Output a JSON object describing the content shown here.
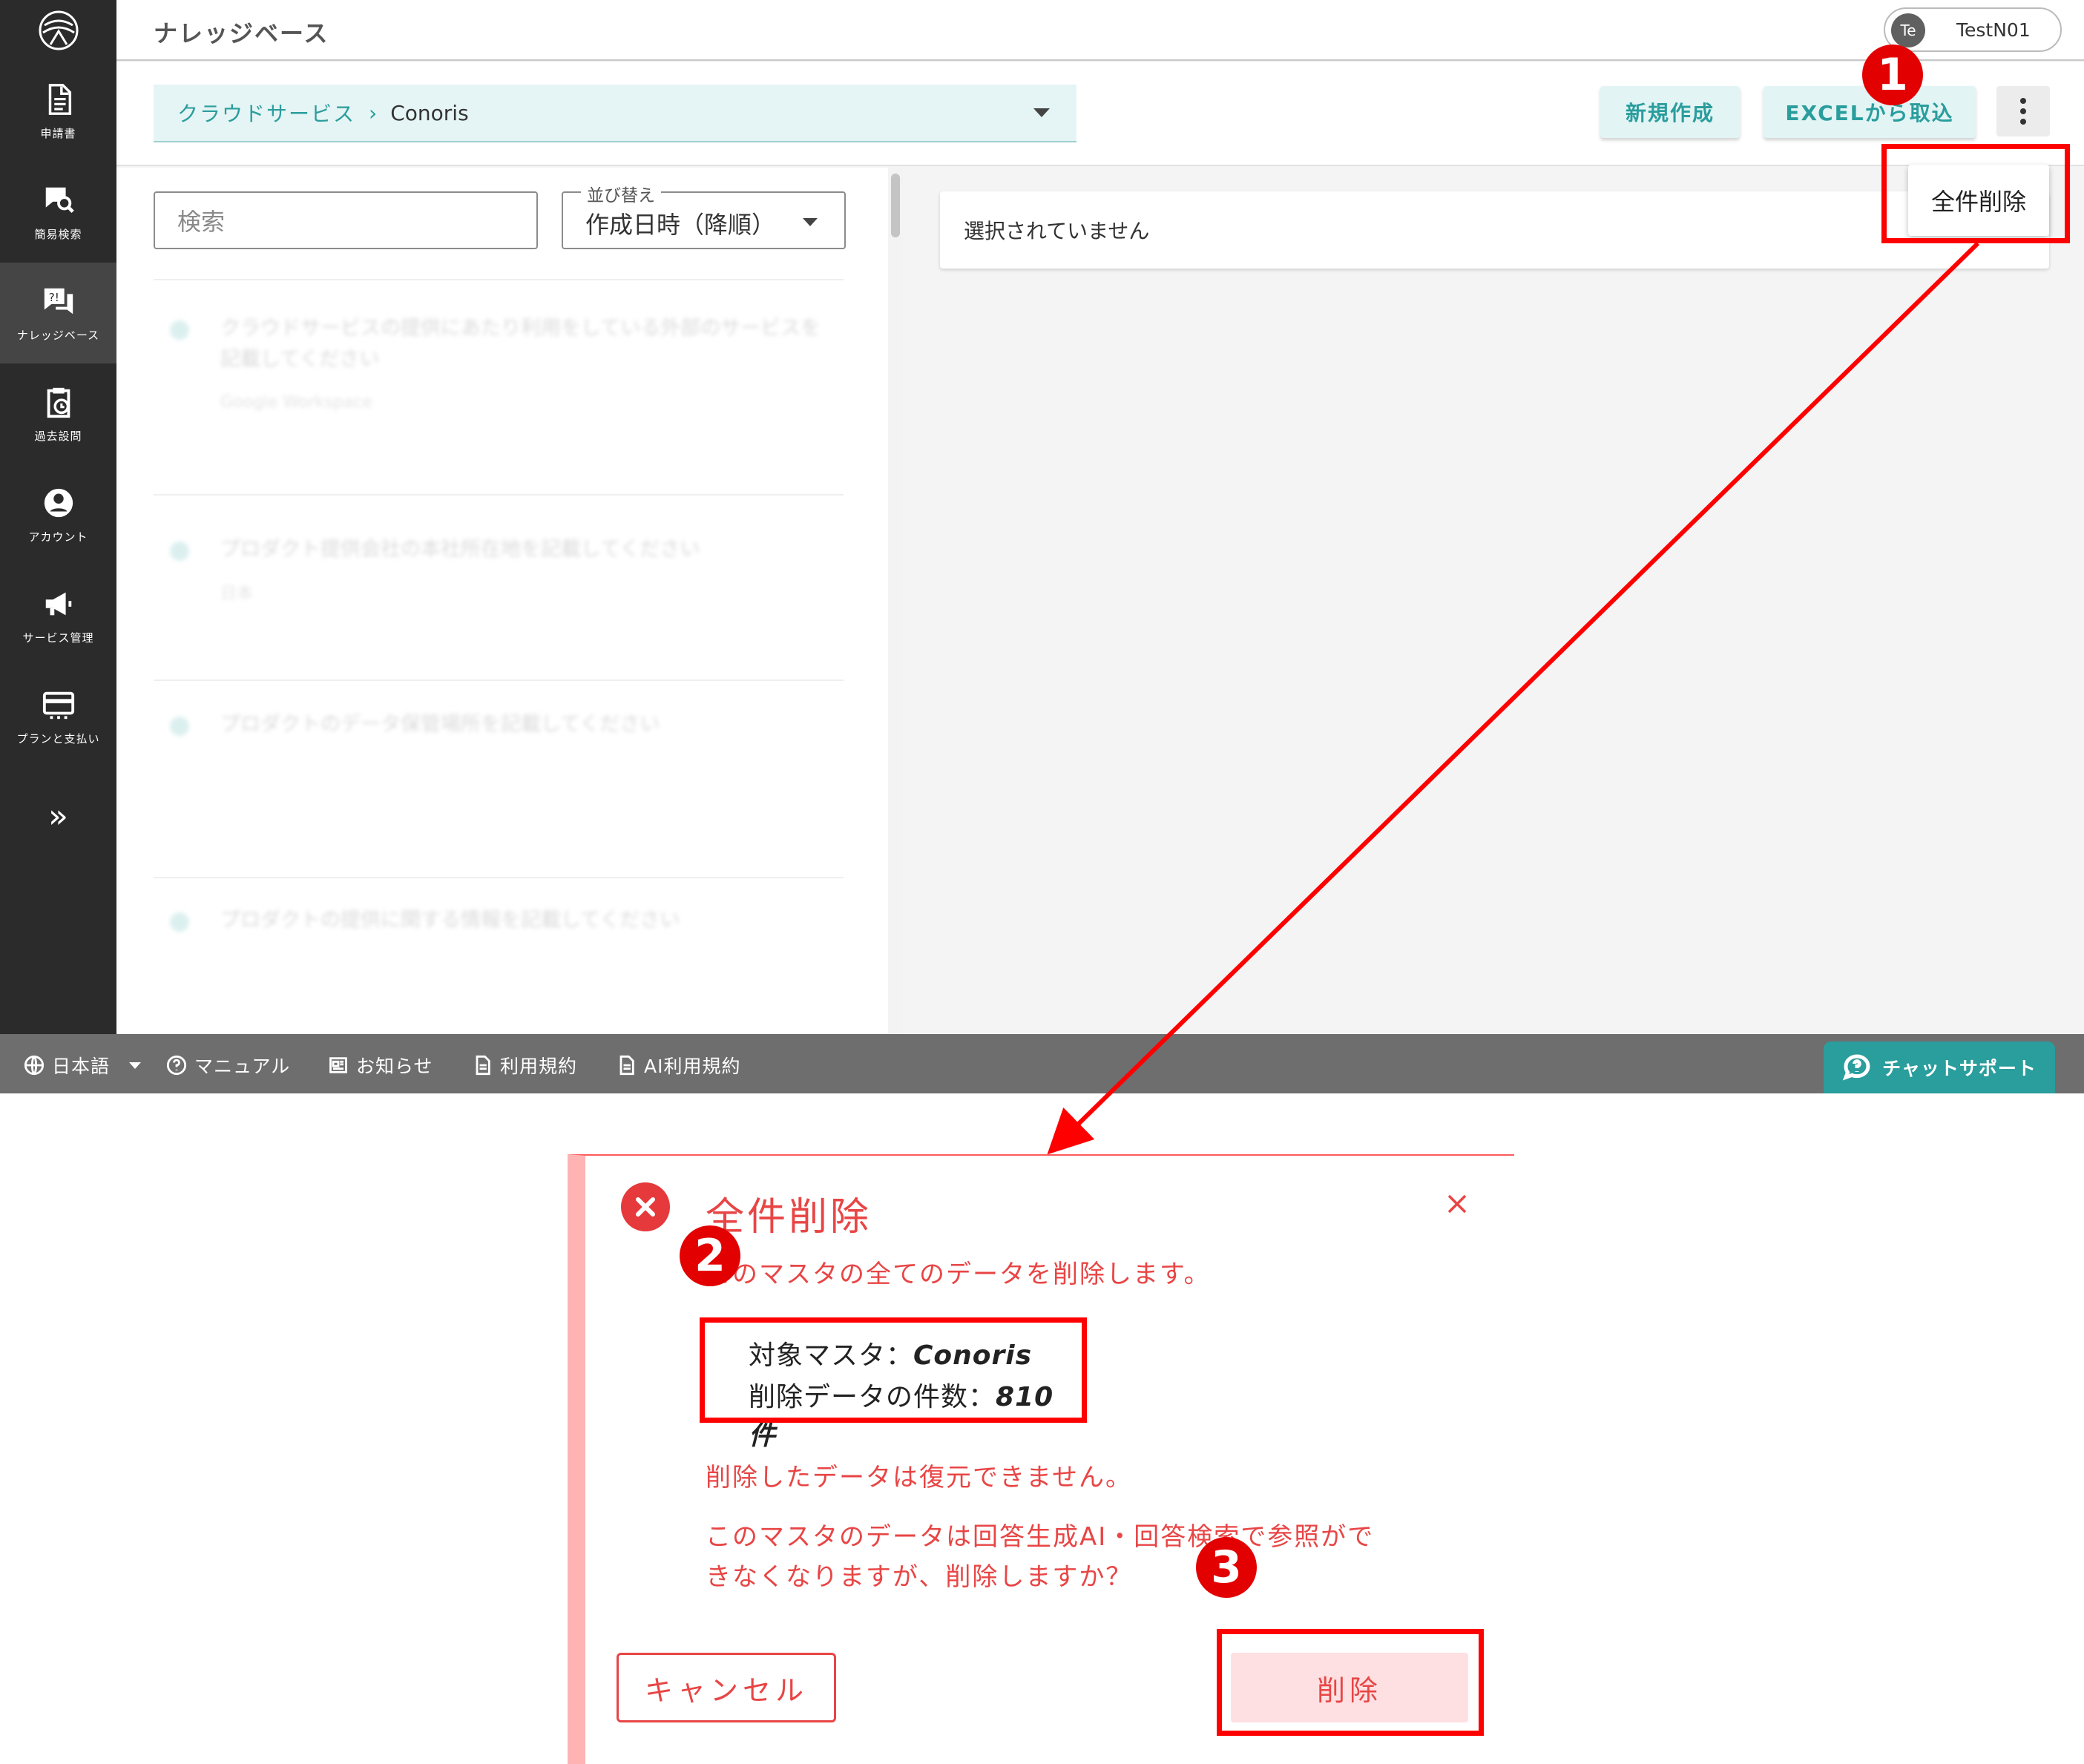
{
  "header": {
    "app_title": "ナレッジベース",
    "user_initials": "Te",
    "user_name": "TestN01"
  },
  "sidebar": {
    "items": [
      {
        "label": "申請書",
        "icon": "document-icon"
      },
      {
        "label": "簡易検索",
        "icon": "chat-search-icon"
      },
      {
        "label": "ナレッジベース",
        "icon": "knowledge-icon",
        "active": true
      },
      {
        "label": "過去設問",
        "icon": "clipboard-clock-icon"
      },
      {
        "label": "アカウント",
        "icon": "account-icon"
      },
      {
        "label": "サービス管理",
        "icon": "megaphone-icon"
      },
      {
        "label": "プランと支払い",
        "icon": "card-icon"
      }
    ],
    "expand_glyph": "»"
  },
  "toolbar": {
    "breadcrumb_root": "クラウドサービス",
    "breadcrumb_sep": "›",
    "breadcrumb_current": "Conoris",
    "new_button": "新規作成",
    "import_button": "EXCELから取込",
    "more_menu_item": "全件削除"
  },
  "list_panel": {
    "search_placeholder": "検索",
    "sort_label": "並び替え",
    "sort_value": "作成日時（降順）",
    "items": [
      {
        "question": "クラウドサービスの提供にあたり利用をしている外部のサービスを記載してください",
        "sub": "Google Workspace"
      },
      {
        "question": "プロダクト提供会社の本社所在地を記載してください",
        "sub": "日本"
      },
      {
        "question": "プロダクトのデータ保管場所を記載してください",
        "sub": ""
      },
      {
        "question": "プロダクトの提供に関する情報を記載してください",
        "sub": ""
      }
    ]
  },
  "detail_panel": {
    "empty_text": "選択されていません"
  },
  "footer": {
    "language": "日本語",
    "manual": "マニュアル",
    "news": "お知らせ",
    "terms": "利用規約",
    "ai_terms": "AI利用規約",
    "chat_support": "チャットサポート"
  },
  "dialog": {
    "title": "全件削除",
    "message": "このマスタの全てのデータを削除します。",
    "target_label": "対象マスタ：",
    "target_value": "Conoris",
    "count_label": "削除データの件数：",
    "count_value": "810件",
    "warning_1": "削除したデータは復元できません。",
    "warning_2a": "このマスタのデータは回答生成AI・回答検索で参照がで",
    "warning_2b": "きなくなりますが、削除しますか？",
    "cancel_button": "キャンセル",
    "delete_button": "削除"
  },
  "annotations": {
    "step1": "1",
    "step2": "2",
    "step3": "3",
    "highlight_color": "#ff0000"
  },
  "colors": {
    "accent_teal": "#2a9d9d",
    "sidebar_bg": "#2b2b2b",
    "danger": "#e84545"
  }
}
